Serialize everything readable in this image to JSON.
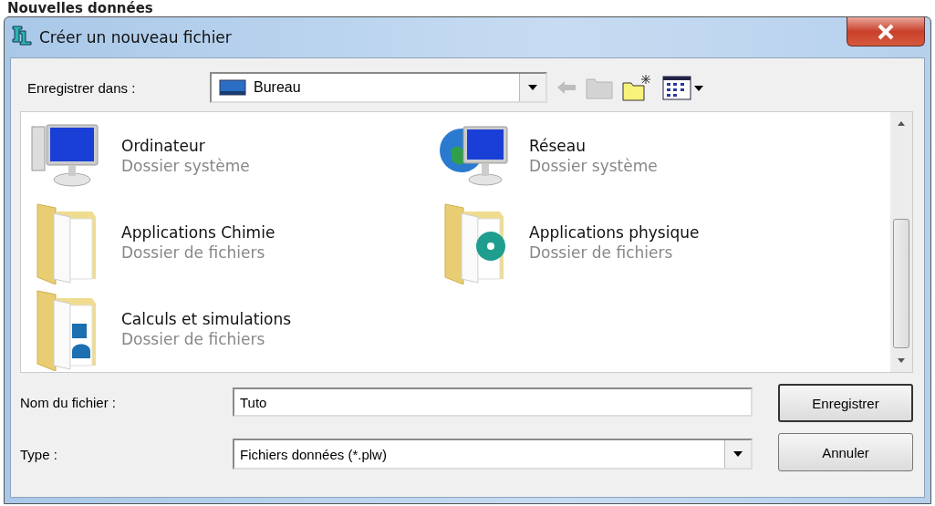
{
  "page_heading": "Nouvelles données",
  "window": {
    "title": "Créer un nouveau fichier"
  },
  "location": {
    "label": "Enregistrer dans :",
    "value": "Bureau"
  },
  "toolbar": [
    {
      "kind": "back",
      "disabled": true
    },
    {
      "kind": "up",
      "disabled": true
    },
    {
      "kind": "new-folder",
      "disabled": false
    },
    {
      "kind": "view-menu",
      "disabled": false
    }
  ],
  "files": [
    {
      "kind": "computer",
      "name": "Ordinateur",
      "type": "Dossier système"
    },
    {
      "kind": "network",
      "name": "Réseau",
      "type": "Dossier système"
    },
    {
      "kind": "folder",
      "name": "Applications Chimie",
      "type": "Dossier de fichiers"
    },
    {
      "kind": "folder-disc",
      "name": "Applications physique",
      "type": "Dossier de fichiers"
    },
    {
      "kind": "folder-doc",
      "name": "Calculs et simulations",
      "type": "Dossier de fichiers"
    }
  ],
  "filename": {
    "label": "Nom du fichier :",
    "value": "Tuto"
  },
  "filetype": {
    "label": "Type :",
    "value": "Fichiers données (*.plw)"
  },
  "buttons": [
    {
      "label": "Enregistrer",
      "default": true
    },
    {
      "label": "Annuler",
      "default": false
    }
  ]
}
